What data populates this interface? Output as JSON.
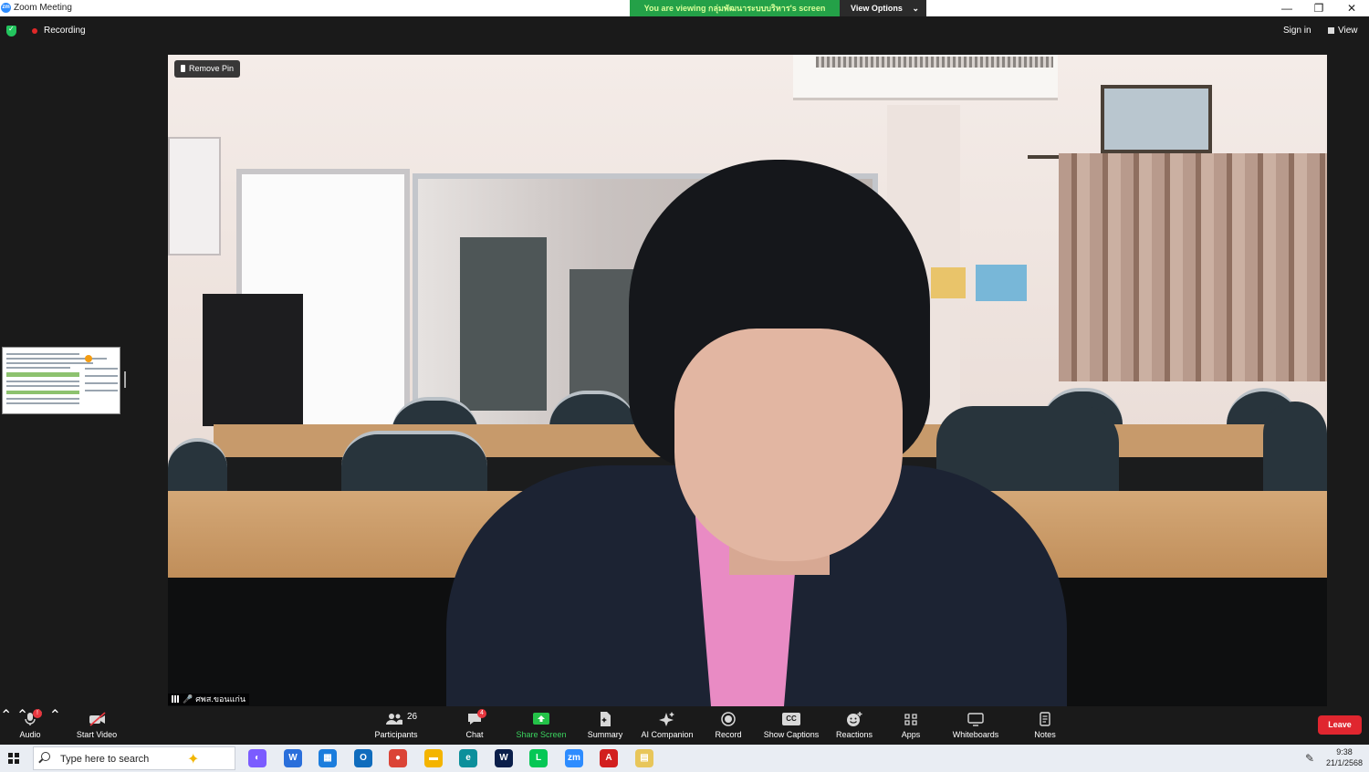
{
  "window": {
    "app_title": "Zoom Meeting",
    "logo_text": "zm",
    "viewing_banner": "You are viewing กลุ่มพัฒนาระบบบริหาร's screen",
    "view_options_label": "View Options",
    "controls": {
      "minimize": "—",
      "restore": "❐",
      "close": "✕"
    }
  },
  "topbar": {
    "recording_label": "Recording",
    "sign_in_label": "Sign in",
    "view_label": "View"
  },
  "video": {
    "remove_pin_label": "Remove Pin",
    "participant_name": "ศพส.ขอนแก่น"
  },
  "toolbar": {
    "audio": {
      "label": "Audio",
      "badge": "!"
    },
    "start_video": {
      "label": "Start Video"
    },
    "participants": {
      "label": "Participants",
      "count": "26"
    },
    "chat": {
      "label": "Chat",
      "badge": "4"
    },
    "share_screen": {
      "label": "Share Screen",
      "color": "#24c248"
    },
    "summary": {
      "label": "Summary"
    },
    "ai_companion": {
      "label": "AI Companion"
    },
    "record": {
      "label": "Record"
    },
    "show_captions": {
      "label": "Show Captions",
      "icon_text": "CC"
    },
    "reactions": {
      "label": "Reactions"
    },
    "apps": {
      "label": "Apps"
    },
    "whiteboards": {
      "label": "Whiteboards"
    },
    "notes": {
      "label": "Notes"
    },
    "leave": {
      "label": "Leave",
      "color": "#e0262f"
    }
  },
  "taskbar": {
    "search_placeholder": "Type here to search",
    "apps": [
      {
        "name": "copilot",
        "glyph": "◐",
        "color": "#7b5cff"
      },
      {
        "name": "w-app",
        "glyph": "W",
        "color": "#2a6fdb"
      },
      {
        "name": "store",
        "glyph": "▦",
        "color": "#1b7ddd"
      },
      {
        "name": "outlook",
        "glyph": "O",
        "color": "#0f6cbd"
      },
      {
        "name": "chrome",
        "glyph": "●",
        "color": "#db4437"
      },
      {
        "name": "file-explorer",
        "glyph": "▬",
        "color": "#f4b400"
      },
      {
        "name": "edge",
        "glyph": "e",
        "color": "#0c8f9b"
      },
      {
        "name": "webex",
        "glyph": "W",
        "color": "#0a1e4a"
      },
      {
        "name": "line",
        "glyph": "L",
        "color": "#06c755"
      },
      {
        "name": "zoom",
        "glyph": "zm",
        "color": "#2d8cff"
      },
      {
        "name": "acrobat",
        "glyph": "A",
        "color": "#d21f1f"
      },
      {
        "name": "notepad",
        "glyph": "▤",
        "color": "#e8c65a"
      }
    ],
    "clock_time": "9:38",
    "clock_date": "21/1/2568"
  }
}
